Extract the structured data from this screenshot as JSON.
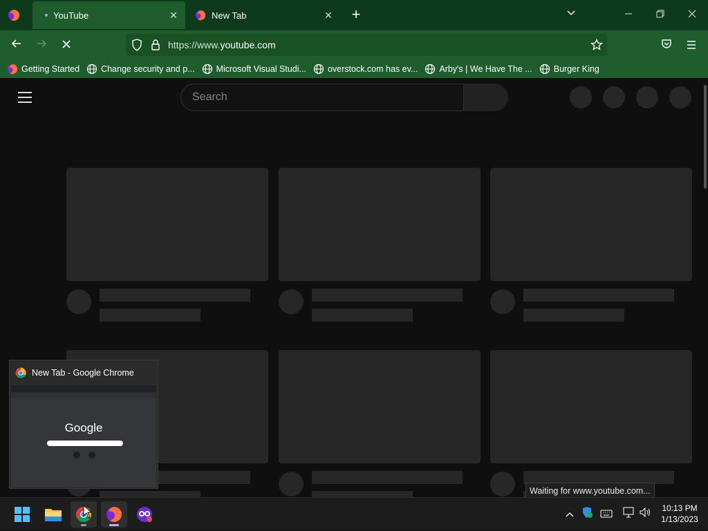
{
  "browser": {
    "tabs": [
      {
        "title": "YouTube",
        "active": true
      },
      {
        "title": "New Tab",
        "active": false
      }
    ],
    "url": {
      "prefix": "https://www.",
      "domain": "youtube.com"
    },
    "bookmarks": [
      {
        "label": "Getting Started",
        "icon": "firefox-icon"
      },
      {
        "label": "Change security and p...",
        "icon": "globe-icon"
      },
      {
        "label": "Microsoft Visual Studi...",
        "icon": "globe-icon"
      },
      {
        "label": "overstock.com has ev...",
        "icon": "globe-icon"
      },
      {
        "label": "Arby's | We Have The ...",
        "icon": "globe-icon"
      },
      {
        "label": "Burger King",
        "icon": "globe-icon"
      }
    ],
    "status_text": "Waiting for www.youtube.com..."
  },
  "youtube": {
    "search_placeholder": "Search"
  },
  "taskbar": {
    "preview_title": "New Tab - Google Chrome",
    "preview_logo": "Google",
    "time": "10:13 PM",
    "date": "1/13/2023"
  },
  "colors": {
    "tabbar_bg": "#0e3a1c",
    "toolbar_bg": "#1f5d2e",
    "page_bg": "#0f0f0f",
    "skeleton": "#272727"
  }
}
